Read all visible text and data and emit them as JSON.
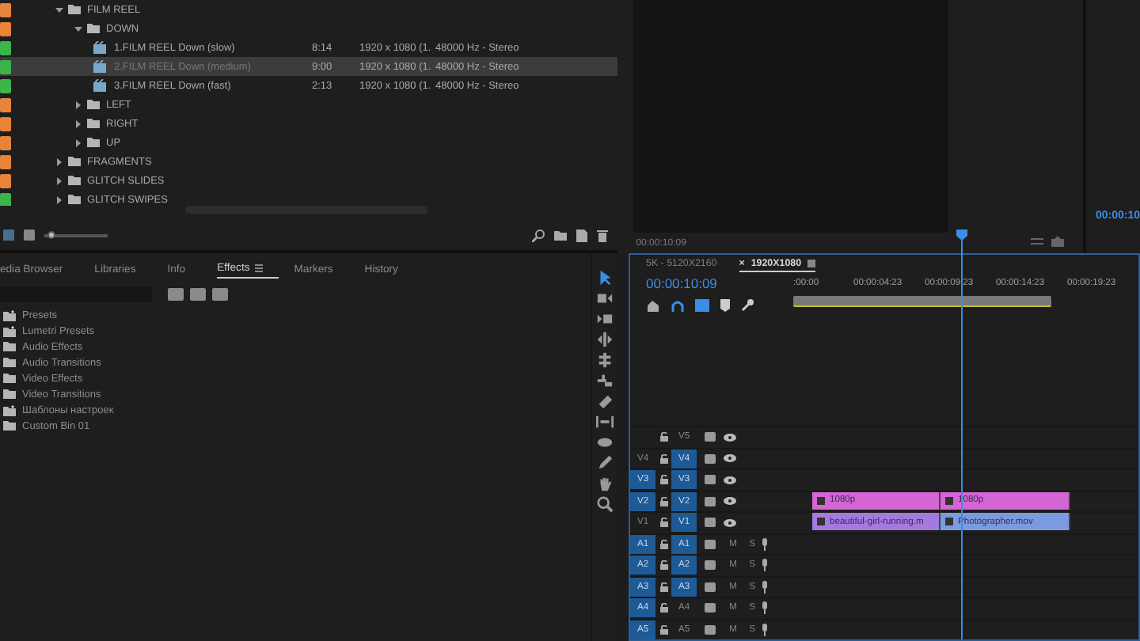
{
  "project": {
    "zoom": {
      "level": 0.1
    },
    "rows": [
      {
        "name": "FILM REEL",
        "kind": "folder",
        "color": "#e8833a",
        "selected": false,
        "expanded": true,
        "children": [
          {
            "name": "DOWN",
            "kind": "folder",
            "color": "#e8833a",
            "selected": false,
            "expanded": true,
            "children": [
              {
                "name": "1.FILM REEL Down (slow)",
                "kind": "clip",
                "color": "#3bb54a",
                "selected": false,
                "duration": "8:14",
                "resolution": "1920 x 1080 (1.",
                "audio": "48000 Hz - Stereo"
              },
              {
                "name": "2.FILM REEL Down (medium)",
                "kind": "clip",
                "color": "#3bb54a",
                "selected": true,
                "duration": "9:00",
                "resolution": "1920 x 1080 (1.",
                "audio": "48000 Hz - Stereo"
              },
              {
                "name": "3.FILM REEL Down (fast)",
                "kind": "clip",
                "color": "#3bb54a",
                "selected": false,
                "duration": "2:13",
                "resolution": "1920 x 1080 (1.",
                "audio": "48000 Hz - Stereo"
              }
            ]
          },
          {
            "name": "LEFT",
            "kind": "folder",
            "color": "#e8833a",
            "selected": false,
            "expanded": false
          },
          {
            "name": "RIGHT",
            "kind": "folder",
            "color": "#e8833a",
            "selected": false,
            "expanded": false
          },
          {
            "name": "UP",
            "kind": "folder",
            "color": "#e8833a",
            "selected": false,
            "expanded": false
          }
        ]
      },
      {
        "name": "FRAGMENTS",
        "kind": "folder",
        "color": "#e8833a",
        "selected": false,
        "expanded": false
      },
      {
        "name": "GLITCH SLIDES",
        "kind": "folder",
        "color": "#e8833a",
        "selected": false,
        "expanded": false
      },
      {
        "name": "GLITCH SWIPES",
        "kind": "folder",
        "color": "#3bb54a",
        "selected": false,
        "expanded": false
      }
    ]
  },
  "effects": {
    "tabs": [
      {
        "label": "edia Browser",
        "selected": false
      },
      {
        "label": "Libraries",
        "selected": false
      },
      {
        "label": "Info",
        "selected": false
      },
      {
        "label": "Effects",
        "selected": true
      },
      {
        "label": "Markers",
        "selected": false
      },
      {
        "label": "History",
        "selected": false
      }
    ],
    "items": [
      {
        "name": "Presets",
        "kind": "preset"
      },
      {
        "name": "Lumetri Presets",
        "kind": "preset"
      },
      {
        "name": "Audio Effects",
        "kind": "folder"
      },
      {
        "name": "Audio Transitions",
        "kind": "folder"
      },
      {
        "name": "Video Effects",
        "kind": "folder"
      },
      {
        "name": "Video Transitions",
        "kind": "folder"
      },
      {
        "name": "Шаблоны настроек",
        "kind": "preset"
      },
      {
        "name": "Custom Bin 01",
        "kind": "folder"
      }
    ]
  },
  "tools": [
    {
      "kind": "selection",
      "selected": true
    },
    {
      "kind": "track-forward",
      "selected": false
    },
    {
      "kind": "track-backward",
      "selected": false
    },
    {
      "kind": "ripple",
      "selected": false
    },
    {
      "kind": "rolling",
      "selected": false
    },
    {
      "kind": "rate",
      "selected": false
    },
    {
      "kind": "razor",
      "selected": false
    },
    {
      "kind": "slip",
      "selected": false
    },
    {
      "kind": "slide",
      "selected": false
    },
    {
      "kind": "pen",
      "selected": false
    },
    {
      "kind": "hand",
      "selected": false
    },
    {
      "kind": "zoom",
      "selected": false
    }
  ],
  "monitor": {
    "timecode": "00:00:10:09"
  },
  "side_panel": {
    "timecode": "00:00:10"
  },
  "timeline": {
    "tabs": [
      {
        "label": "5K - 5120X2160",
        "selected": false
      },
      {
        "label": "1920X1080",
        "selected": true,
        "close": "×"
      }
    ],
    "timecode": "00:00:10:09",
    "ruler": [
      ":00:00",
      "00:00:04:23",
      "00:00:09:23",
      "00:00:14:23",
      "00:00:19:23"
    ],
    "video_tracks": [
      {
        "name": "V5",
        "targeted": false
      },
      {
        "name": "V4",
        "targeted": true,
        "source": {
          "label": "V4",
          "selected": false
        }
      },
      {
        "name": "V3",
        "targeted": true,
        "source": {
          "label": "V3",
          "selected": true
        }
      },
      {
        "name": "V2",
        "targeted": true,
        "source": {
          "label": "V2",
          "selected": true
        },
        "clips": [
          {
            "name": "1080p",
            "color": "#d466d4"
          },
          {
            "name": "1080p",
            "color": "#d466d4"
          }
        ]
      },
      {
        "name": "V1",
        "targeted": true,
        "source": {
          "label": "V1",
          "selected": false
        },
        "clips": [
          {
            "name": "beautiful-girl-running.m",
            "color": "#a57ae0"
          },
          {
            "name": "Photographer.mov",
            "color": "#7b9be0"
          }
        ]
      }
    ],
    "audio_tracks": [
      {
        "name": "A1",
        "targeted": true,
        "source": {
          "label": "A1",
          "selected": true
        },
        "mute": "M",
        "solo": "S"
      },
      {
        "name": "A2",
        "targeted": true,
        "source": {
          "label": "A2",
          "selected": true
        },
        "mute": "M",
        "solo": "S"
      },
      {
        "name": "A3",
        "targeted": true,
        "source": {
          "label": "A3",
          "selected": true
        },
        "mute": "M",
        "solo": "S"
      },
      {
        "name": "A4",
        "targeted": false,
        "source": {
          "label": "A4",
          "selected": true
        },
        "mute": "M",
        "solo": "S"
      },
      {
        "name": "A5",
        "targeted": false,
        "source": {
          "label": "A5",
          "selected": true
        },
        "mute": "M",
        "solo": "S"
      }
    ]
  }
}
